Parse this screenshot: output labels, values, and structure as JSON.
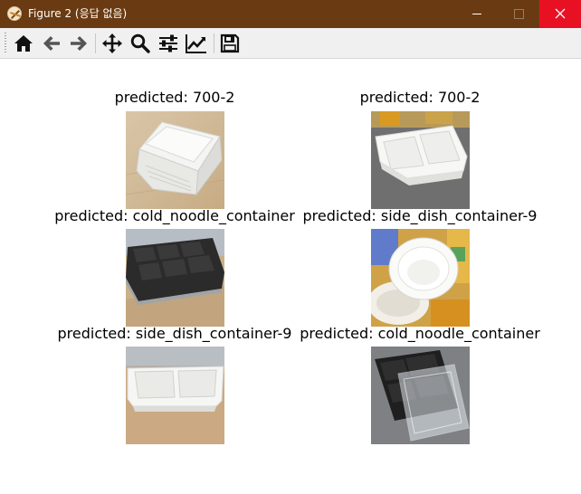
{
  "window": {
    "title": "Figure 2 (응답 없음)",
    "controls": {
      "minimize": "minimize",
      "maximize": "maximize",
      "close": "close"
    }
  },
  "toolbar": {
    "buttons": [
      {
        "icon": "home-icon",
        "label": "Home"
      },
      {
        "icon": "arrow-left-icon",
        "label": "Back"
      },
      {
        "icon": "arrow-right-icon",
        "label": "Forward"
      },
      {
        "icon": "move-icon",
        "label": "Pan"
      },
      {
        "icon": "search-icon",
        "label": "Zoom"
      },
      {
        "icon": "sliders-icon",
        "label": "Subplots"
      },
      {
        "icon": "chart-line-icon",
        "label": "Customize"
      },
      {
        "icon": "save-icon",
        "label": "Save"
      }
    ]
  },
  "figure": {
    "subplots": [
      {
        "title": "predicted: 700-2",
        "image": "white tray with ridged sides on wooden table"
      },
      {
        "title": "predicted: 700-2",
        "image": "white two-compartment tray on gray table"
      },
      {
        "title": "predicted: cold_noodle_container",
        "image": "black multi-compartment tray on wooden table"
      },
      {
        "title": "predicted: side_dish_container-9",
        "image": "white round bowl on colorful cups"
      },
      {
        "title": "predicted: side_dish_container-9",
        "image": "white two-compartment tray on wooden table"
      },
      {
        "title": "predicted: cold_noodle_container",
        "image": "black tray with clear lid on gray table"
      }
    ]
  },
  "colors": {
    "titlebar": "#6a3b12",
    "close_button": "#e81123",
    "toolbar": "#f0f0f0",
    "canvas": "#ffffff"
  }
}
